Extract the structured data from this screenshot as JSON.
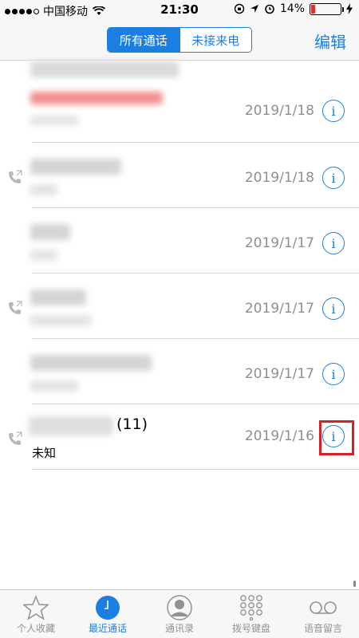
{
  "status_bar": {
    "carrier": "中国移动",
    "time": "21:30",
    "battery": "14%",
    "battery_level": 0.14
  },
  "nav": {
    "segments": [
      "所有通话",
      "未接来电"
    ],
    "active_segment": 0,
    "edit_label": "编辑"
  },
  "calls": [
    {
      "date": "2019/1/18",
      "outgoing_icon": false
    },
    {
      "date": "2019/1/18",
      "outgoing_icon": true
    },
    {
      "date": "2019/1/17",
      "outgoing_icon": false
    },
    {
      "date": "2019/1/17",
      "outgoing_icon": true
    },
    {
      "date": "2019/1/17",
      "outgoing_icon": false
    },
    {
      "date": "2019/1/16",
      "outgoing_icon": true,
      "count_label": "(11)",
      "subtitle": "未知",
      "highlighted": true
    }
  ],
  "tabs": [
    {
      "label": "个人收藏",
      "icon": "star-icon"
    },
    {
      "label": "最近通话",
      "icon": "clock-icon",
      "active": true
    },
    {
      "label": "通讯录",
      "icon": "contact-icon"
    },
    {
      "label": "拨号键盘",
      "icon": "keypad-icon"
    },
    {
      "label": "语音留言",
      "icon": "voicemail-icon"
    }
  ],
  "colors": {
    "accent": "#1a7fe0",
    "highlight": "#d1222a",
    "secondary_text": "#8e8e93"
  }
}
